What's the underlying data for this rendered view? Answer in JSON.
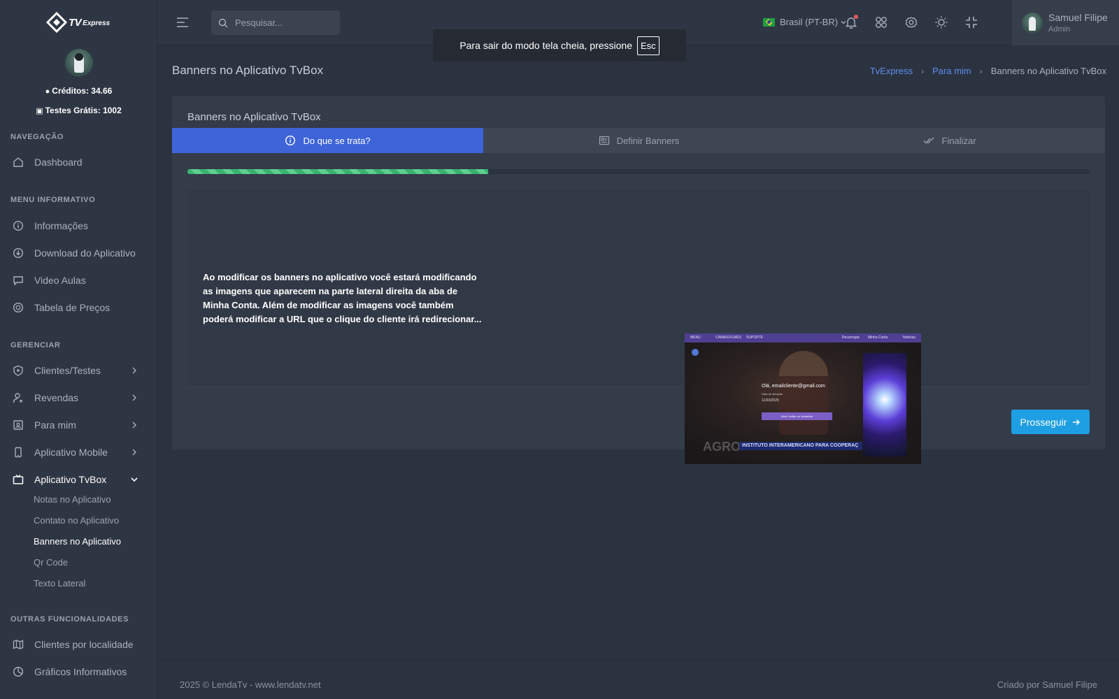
{
  "sidebar": {
    "brand_main": "TV",
    "brand_sub": "Express",
    "credits": "Créditos: 34.66",
    "trials": "Testes Grátis: 1002",
    "sections": {
      "nav": "NAVEGAÇÃO",
      "menu": "MENU INFORMATIVO",
      "manage": "GERENCIAR",
      "other": "OUTRAS FUNCIONALIDADES"
    },
    "items": {
      "dashboard": "Dashboard",
      "informacoes": "Informações",
      "download": "Download do Aplicativo",
      "video": "Video Aulas",
      "precos": "Tabela de Preços",
      "clientes": "Clientes/Testes",
      "revendas": "Revendas",
      "para_mim": "Para mim",
      "mobile": "Aplicativo Mobile",
      "tvbox": "Aplicativo TvBox",
      "localidade": "Clientes por localidade",
      "graficos": "Gráficos Informativos"
    },
    "subitems": {
      "notas": "Notas no Aplicativo",
      "contato": "Contato no Aplicativo",
      "banners": "Banners no Aplicativo",
      "qr": "Qr Code",
      "texto": "Texto Lateral"
    }
  },
  "topbar": {
    "search_placeholder": "Pesquisar...",
    "language": "Brasil (PT-BR)",
    "user_name": "Samuel Filipe",
    "user_role": "Admin"
  },
  "toast": {
    "text": "Para sair do modo tela cheia, pressione",
    "key": "Esc"
  },
  "page": {
    "title": "Banners no Aplicativo TvBox",
    "breadcrumb": [
      "TvExpress",
      "Para mim",
      "Banners no Aplicativo TvBox"
    ]
  },
  "wizard": {
    "card_title": "Banners no Aplicativo TvBox",
    "steps": [
      "Do que se trata?",
      "Definir Banners",
      "Finalizar"
    ],
    "active_step": 0,
    "progress_fraction": 0.333,
    "description": "Ao modificar os banners no aplicativo você estará modificando as imagens que aparecem na parte lateral direita da aba de Minha Conta. Além de modificar as imagens você também poderá modificar a URL que o clique do cliente irá redirecionar...",
    "next_label": "Prosseguir",
    "preview": {
      "menu": [
        "MENU",
        "CANAIS",
        "FILMES",
        "SUPORTE"
      ],
      "recarregar": "Recarregar",
      "minha_conta": "Minha Conta",
      "noticias": "Notícias",
      "hello": "Olá, emailcliente@gmail.com",
      "data_label": "Data de ativação",
      "date": "11/03/2025",
      "button": "Abrir Cartão do Vendedor",
      "strip": "INSTITUTO INTERAMERICANO PARA COOPERAÇ",
      "agro": "AGRO"
    }
  },
  "footer": {
    "left": "2025 © LendaTv - www.lendatv.net",
    "right": "Criado por Samuel Filipe"
  },
  "colors": {
    "accent": "#3e64d8",
    "button": "#1e9fe4",
    "progress": "#39b36f",
    "link": "#5b8def"
  }
}
